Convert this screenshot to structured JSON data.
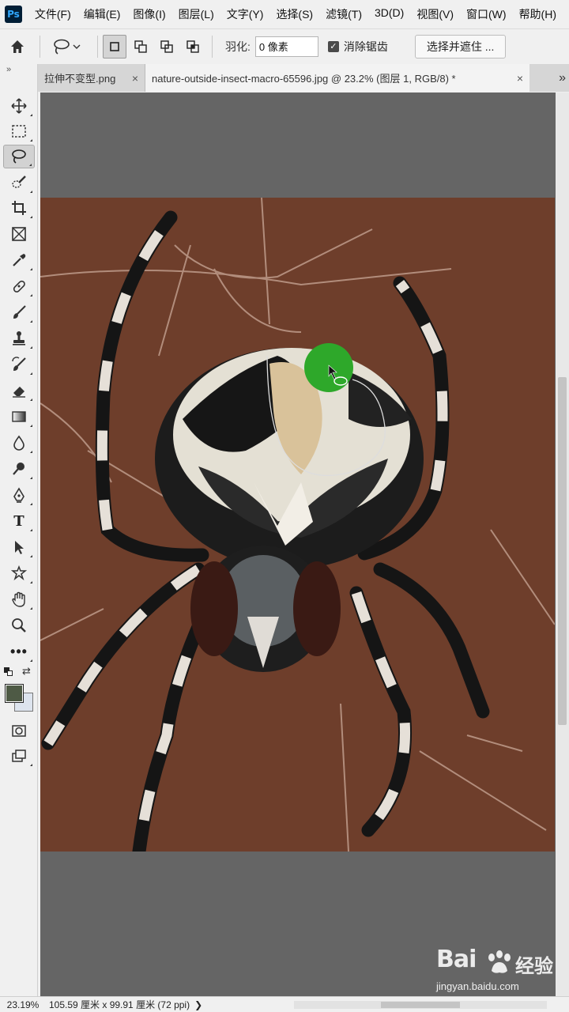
{
  "app": {
    "logo": "Ps"
  },
  "menu": [
    "文件(F)",
    "编辑(E)",
    "图像(I)",
    "图层(L)",
    "文字(Y)",
    "选择(S)",
    "滤镜(T)",
    "3D(D)",
    "视图(V)",
    "窗口(W)",
    "帮助(H)"
  ],
  "options": {
    "feather_label": "羽化:",
    "feather_value": "0 像素",
    "antialias_label": "消除锯齿",
    "antialias_checked": true,
    "select_mask_button": "选择并遮住 ..."
  },
  "tabs": [
    {
      "label": "拉伸不变型.png",
      "active": false
    },
    {
      "label": "nature-outside-insect-macro-65596.jpg @ 23.2% (图层 1, RGB/8) *",
      "active": true
    }
  ],
  "tools": [
    "move-tool",
    "marquee-tool",
    "lasso-tool",
    "quick-selection-tool",
    "crop-tool",
    "frame-tool",
    "eyedropper-tool",
    "healing-brush-tool",
    "brush-tool",
    "clone-stamp-tool",
    "history-brush-tool",
    "eraser-tool",
    "gradient-tool",
    "blur-tool",
    "dodge-tool",
    "pen-tool",
    "type-tool",
    "path-selection-tool",
    "shape-tool",
    "hand-tool",
    "zoom-tool",
    "more-tools"
  ],
  "colors": {
    "foreground": "#4e5a45",
    "background": "#dde4ee",
    "canvas_background": "#6e3e2b",
    "cursor_highlight": "#2ea82a"
  },
  "status": {
    "zoom": "23.19%",
    "doc_size": "105.59 厘米 x 99.91 厘米 (72 ppi)",
    "arrow": "❯"
  },
  "watermark": {
    "brand": "Bai",
    "brand_suffix": "经验",
    "url": "jingyan.baidu.com"
  }
}
